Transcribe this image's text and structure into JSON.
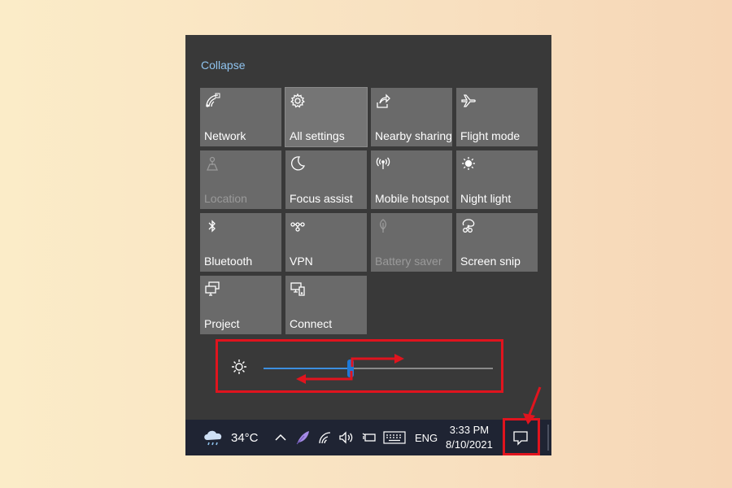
{
  "action_center": {
    "collapse_label": "Collapse",
    "tiles": [
      {
        "label": "Network",
        "icon": "wifi-icon",
        "state": "enabled"
      },
      {
        "label": "All settings",
        "icon": "gear-icon",
        "state": "enabled"
      },
      {
        "label": "Nearby sharing",
        "icon": "share-icon",
        "state": "enabled"
      },
      {
        "label": "Flight mode",
        "icon": "airplane-icon",
        "state": "enabled"
      },
      {
        "label": "Location",
        "icon": "location-icon",
        "state": "disabled"
      },
      {
        "label": "Focus assist",
        "icon": "moon-icon",
        "state": "enabled"
      },
      {
        "label": "Mobile hotspot",
        "icon": "hotspot-icon",
        "state": "enabled"
      },
      {
        "label": "Night light",
        "icon": "sun-icon",
        "state": "enabled"
      },
      {
        "label": "Bluetooth",
        "icon": "bluetooth-icon",
        "state": "enabled"
      },
      {
        "label": "VPN",
        "icon": "vpn-icon",
        "state": "enabled"
      },
      {
        "label": "Battery saver",
        "icon": "leaf-icon",
        "state": "disabled"
      },
      {
        "label": "Screen snip",
        "icon": "scissors-icon",
        "state": "enabled"
      },
      {
        "label": "Project",
        "icon": "project-icon",
        "state": "enabled"
      },
      {
        "label": "Connect",
        "icon": "connect-icon",
        "state": "enabled"
      }
    ],
    "brightness": {
      "level_percent": 38,
      "icon": "sun-icon"
    }
  },
  "taskbar": {
    "weather_icon": "cloud-rain-icon",
    "temperature": "34°C",
    "language": "ENG",
    "time": "3:33 PM",
    "date": "8/10/2021",
    "tray_icons": [
      "chevron-up-icon",
      "feather-icon",
      "wifi-icon",
      "speaker-icon",
      "battery-icon",
      "keyboard-icon"
    ],
    "notification_icon": "notification-icon"
  },
  "colors": {
    "panel_bg": "#393939",
    "tile_bg": "#6a6a6a",
    "accent": "#1e78d6",
    "annotation": "#e0141e",
    "taskbar_bg": "#1f2433",
    "collapse_link": "#8fc3ee"
  }
}
